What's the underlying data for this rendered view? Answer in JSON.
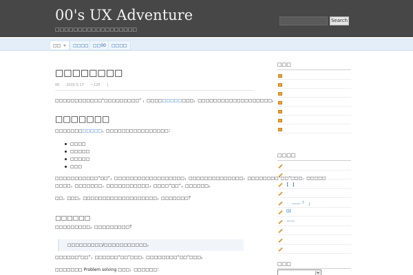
{
  "header": {
    "site_title": "00's UX Adventure",
    "site_description": "□□□□□□□□□□□□□□□□□□",
    "search_placeholder": "",
    "search_button": "Search"
  },
  "nav": {
    "items": [
      {
        "label": "□□"
      },
      {
        "label": "□□□□"
      },
      {
        "label": "□□00"
      },
      {
        "label": "□□□□"
      }
    ]
  },
  "post": {
    "title": "□□□□□□□□",
    "meta": {
      "author": "00",
      "date": "2015.5.17",
      "views": "~125",
      "comments": "|"
    },
    "intro_before": "□□□□□□□□□□□□“□□□□□□□□□” ，□□□□",
    "intro_link": "□□□□□",
    "intro_after": "□□□，□□□□□□□□□□□□□□□□□□□。",
    "heading": "□□□□□□□",
    "list_intro_before": "□□□□□□□",
    "list_intro_link": "□□□□□",
    "list_intro_after": "，□□□□□□□□□□□□□□□□：",
    "bullets": [
      "□□□□",
      "□□□□□",
      "□□□□□",
      "□□□"
    ],
    "para3_line1": "□□□□□□□□□□□“□□”，□□□□□□□□□□□□□□□□□□，□□□□□□□□□□□□□□，□□□□□□□□“□□”□□□，□□□□□",
    "para3_line2": "□□□□，□□□□□□□，□□□□□□□□□□□，□□□□“□□”，□□□□□□。",
    "para4": "□□，□□□，□□□□□□□□□□□□□□□□□□□，□□□□□□□？",
    "subheading": "□□□□□□",
    "para5": "□□□□□□□□□，□□□□□□□□□？",
    "quote": "□□□□□□□□□/□□□□□□□□□□□。",
    "para6": "□□□□□□“□□”，□□□□□□“□□”□□□，□□□□□□□□“□□”□□□。",
    "para7": "□□□□□□□ Problem solving □□□，□□□□□□："
  },
  "sidebar": {
    "widget1_title": "□□□",
    "widget1_items": 7,
    "widget2_title": "□□□□",
    "widget2_items": [
      "",
      "",
      "【　】",
      "",
      "——「　」",
      "Gt",
      "——",
      "",
      "",
      ""
    ],
    "widget3_title": "□□□"
  },
  "colors": {
    "header_bg": "#474747",
    "nav_bg": "#e3eef9",
    "link": "#1a6fb8",
    "rss": "#f0a535"
  }
}
